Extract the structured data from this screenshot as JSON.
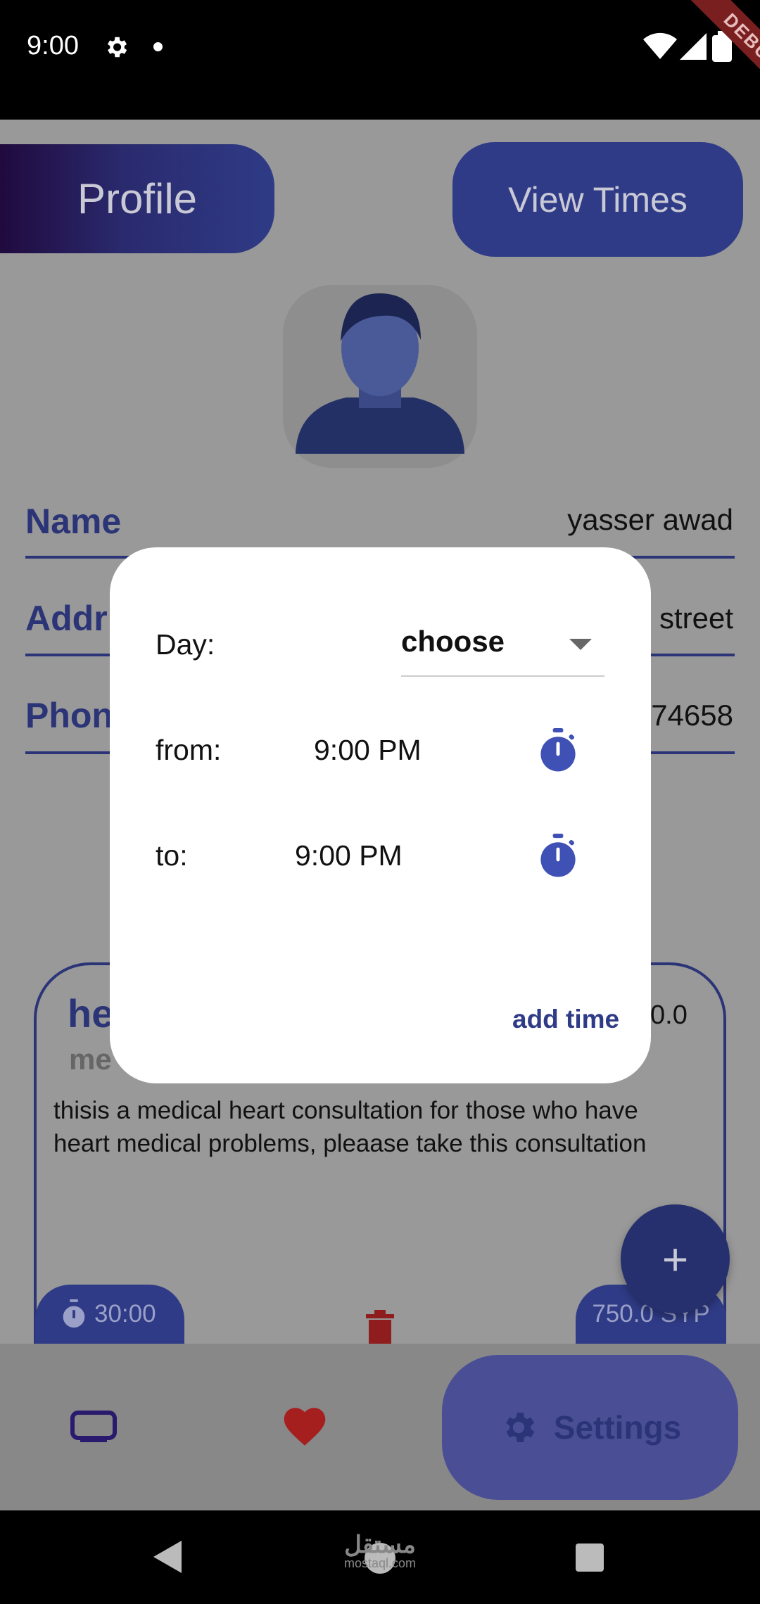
{
  "status_bar": {
    "time": "9:00",
    "debug_label": "DEBUG"
  },
  "header": {
    "profile_label": "Profile",
    "view_times_label": "View Times"
  },
  "fields": {
    "name": {
      "label": "Name",
      "value": "yasser awad"
    },
    "address": {
      "label": "Addr",
      "value": "street"
    },
    "phone": {
      "label": "Phon",
      "value": "74658"
    }
  },
  "consultation": {
    "title": "he",
    "subtitle": "me",
    "price_partial": "0.0",
    "description": "thisis a medical heart consultation for those who have heart medical problems, pleaase take this consultation",
    "duration": "30:00",
    "price": "750.0 SYP"
  },
  "fab_label": "+",
  "bottom_nav": {
    "settings_label": "Settings"
  },
  "dialog": {
    "day_label": "Day:",
    "day_value": "choose",
    "from_label": "from:",
    "from_time": "9:00 PM",
    "to_label": "to:",
    "to_time": "9:00 PM",
    "add_time_label": "add time"
  },
  "watermark": {
    "arabic": "مستقل",
    "latin": "mostaql.com"
  },
  "colors": {
    "accent": "#2f3b86",
    "timer_icon": "#3f51b5",
    "delete_icon": "#9a1f1f",
    "favorite_icon": "#c42a2a"
  }
}
